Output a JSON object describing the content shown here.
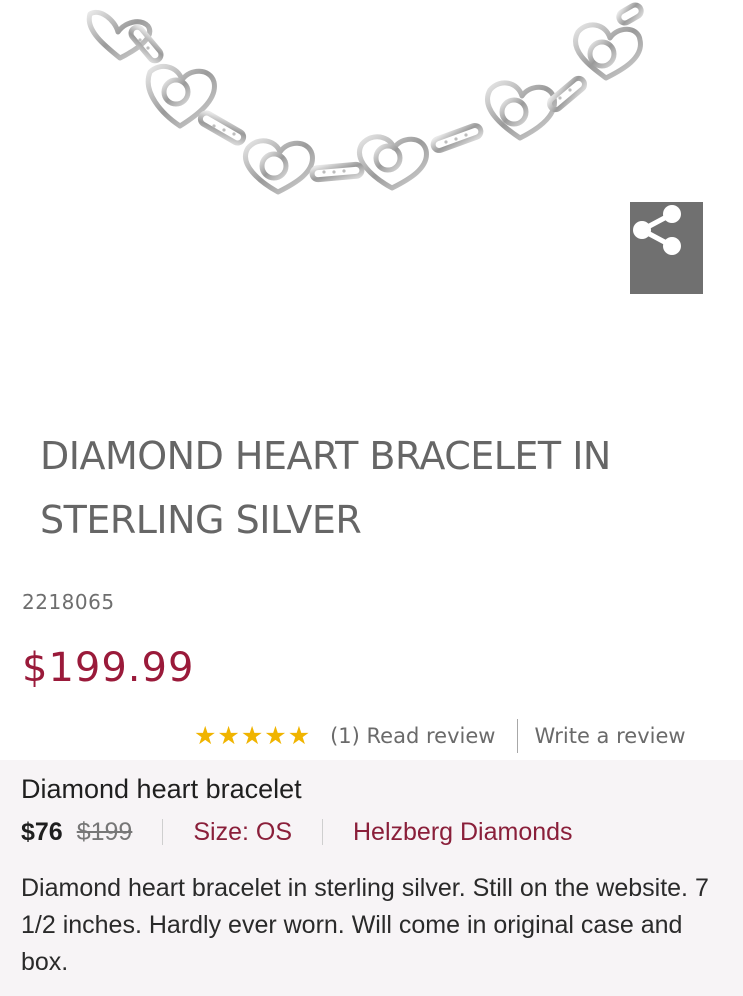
{
  "product": {
    "image_alt": "Diamond heart bracelet in sterling silver",
    "share_icon": "share-icon",
    "title": "DIAMOND HEART BRACELET IN STERLING SILVER",
    "sku": "2218065",
    "price": "$199.99"
  },
  "reviews": {
    "rating": 5,
    "max_rating": 5,
    "count_label": "(1) Read review",
    "write_label": "Write a review",
    "star_color": "#f0b400"
  },
  "listing": {
    "title": "Diamond heart bracelet",
    "price": "$76",
    "original_price": "$199",
    "size": "Size: OS",
    "brand": "Helzberg Diamonds",
    "description": "Diamond heart bracelet in sterling silver. Still on the website. 7 1/2 inches. Hardly ever worn. Will come in original case and box."
  },
  "colors": {
    "price_accent": "#9a1a3a",
    "brand_accent": "#8a1f3a",
    "listing_bg": "#f7f4f6"
  }
}
